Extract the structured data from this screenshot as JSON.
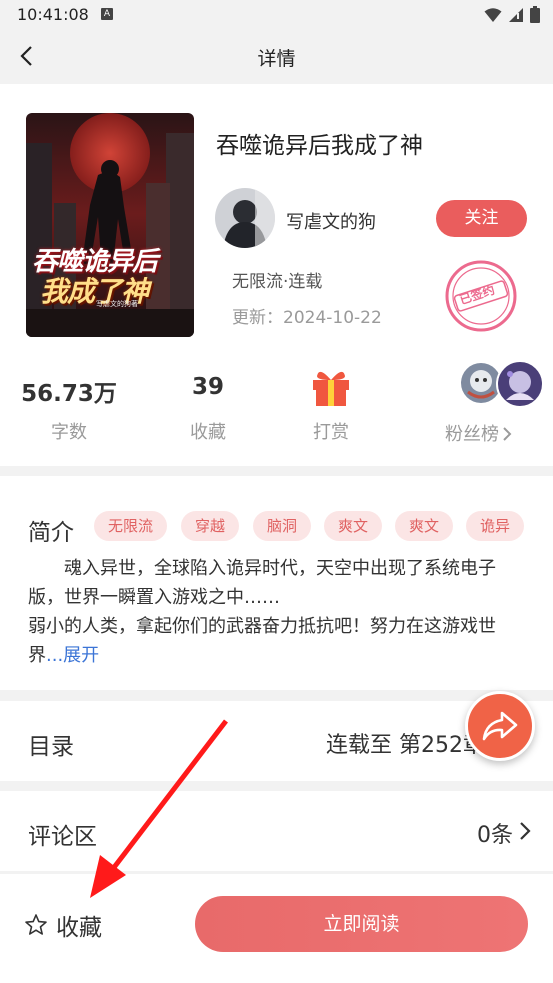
{
  "status_bar": {
    "time": "10:41:08",
    "notif_icon": "A"
  },
  "nav": {
    "title": "详情"
  },
  "book": {
    "title": "吞噬诡异后我成了神",
    "cover_text_line1": "吞噬诡异后",
    "cover_text_line2": "我成了神",
    "cover_author_small": "写虐文的狗著",
    "author": "写虐文的狗",
    "follow_label": "关注",
    "genre_status": "无限流·连载",
    "update": "更新：2024-10-22",
    "stamp_text": "已签约"
  },
  "stats": {
    "words": {
      "value": "56.73万",
      "label": "字数"
    },
    "favorites": {
      "value": "39",
      "label": "收藏"
    },
    "reward": {
      "label": "打赏"
    },
    "fans": {
      "label": "粉丝榜"
    }
  },
  "intro": {
    "title": "简介",
    "tags": [
      "无限流",
      "穿越",
      "脑洞",
      "爽文",
      "爽文",
      "诡异"
    ],
    "line1": "魂入异世，全球陷入诡异时代，天空中出现了系统电子版，世界一瞬置入游戏之中……",
    "line2": "弱小的人类，拿起你们的武器奋力抵抗吧！努力在这游戏世界",
    "expand": "...展开"
  },
  "catalog": {
    "label": "目录",
    "value": "连载至 第252章"
  },
  "comments": {
    "label": "评论区",
    "value": "0条"
  },
  "bottom": {
    "favorite_label": "收藏",
    "read_label": "立即阅读"
  },
  "colors": {
    "accent": "#ea5d5d",
    "tag_bg": "#fbe5e5",
    "link": "#3b74d6",
    "fab": "#f06347"
  }
}
